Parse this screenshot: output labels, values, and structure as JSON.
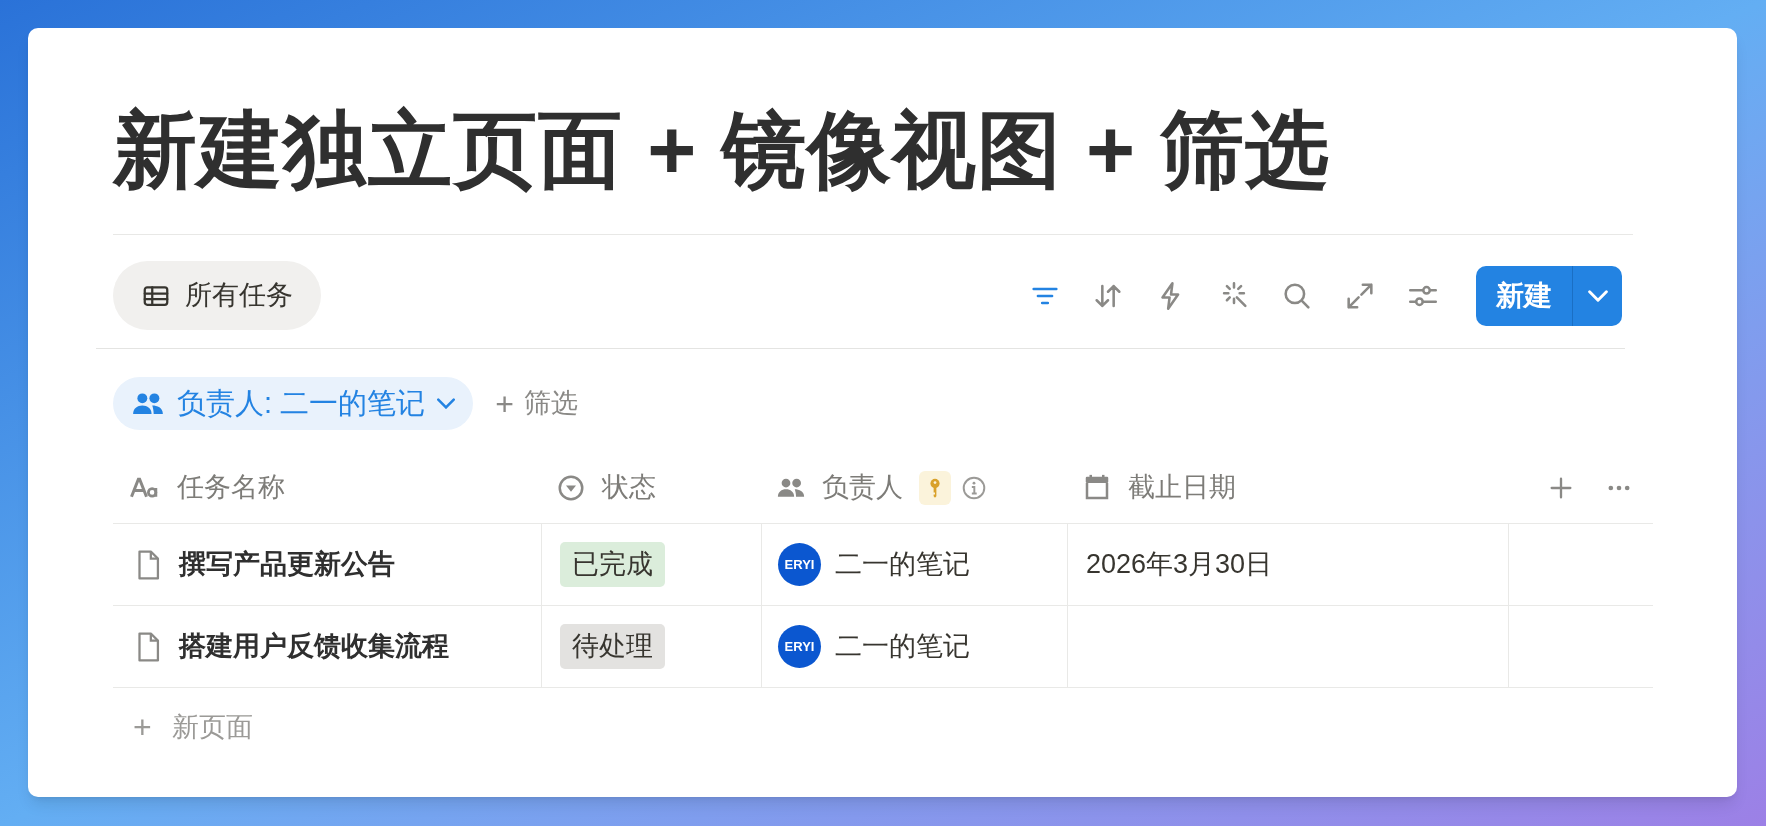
{
  "page": {
    "title": "新建独立页面 + 镜像视图 + 筛选"
  },
  "view_tab": {
    "label": "所有任务",
    "selected": true
  },
  "toolbar": [
    {
      "kind": "filter",
      "active": true
    },
    {
      "kind": "sort",
      "active": false
    },
    {
      "kind": "automation",
      "active": false
    },
    {
      "kind": "ai",
      "active": false
    },
    {
      "kind": "search",
      "active": false
    },
    {
      "kind": "expand",
      "active": false
    },
    {
      "kind": "settings",
      "active": false
    }
  ],
  "new_button": {
    "label": "新建"
  },
  "filter_chip": {
    "label": "负责人: 二一的笔记"
  },
  "add_filter": {
    "label": "筛选",
    "icon": "+"
  },
  "table": {
    "columns": [
      {
        "kind": "title",
        "label": "任务名称"
      },
      {
        "kind": "status",
        "label": "状态"
      },
      {
        "kind": "person",
        "label": "负责人"
      },
      {
        "kind": "date",
        "label": "截止日期"
      }
    ],
    "rows": [
      {
        "name": "撰写产品更新公告",
        "status": {
          "label": "已完成",
          "color": "#dbeddb"
        },
        "assignee": {
          "avatar": "ERYI",
          "name": "二一的笔记"
        },
        "due": "2026年3月30日"
      },
      {
        "name": "搭建用户反馈收集流程",
        "status": {
          "label": "待处理",
          "color": "#e3e2e0"
        },
        "assignee": {
          "avatar": "ERYI",
          "name": "二一的笔记"
        }
      }
    ],
    "add_row": {
      "icon": "+",
      "label": "新页面"
    }
  }
}
